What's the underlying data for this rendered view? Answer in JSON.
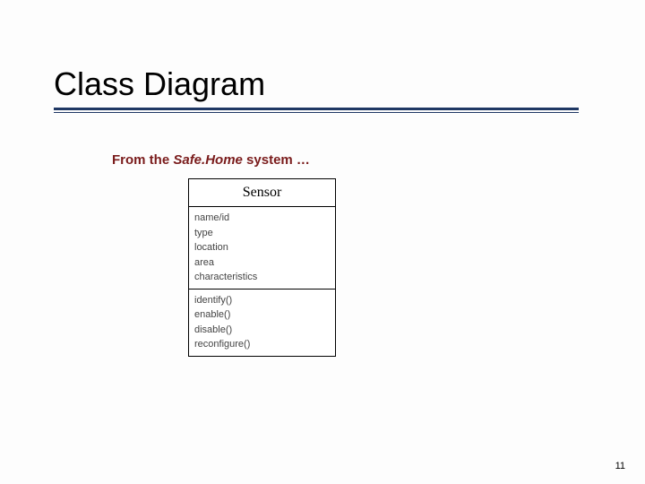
{
  "slide": {
    "title": "Class Diagram",
    "subtitle_prefix": "From the ",
    "subtitle_italic": "Safe.Home",
    "subtitle_suffix": " system …",
    "page_number": "11"
  },
  "uml": {
    "class_name": "Sensor",
    "attributes": [
      "name/id",
      "type",
      "location",
      "area",
      "characteristics"
    ],
    "operations": [
      "identify()",
      "enable()",
      "disable()",
      "reconfigure()"
    ]
  }
}
